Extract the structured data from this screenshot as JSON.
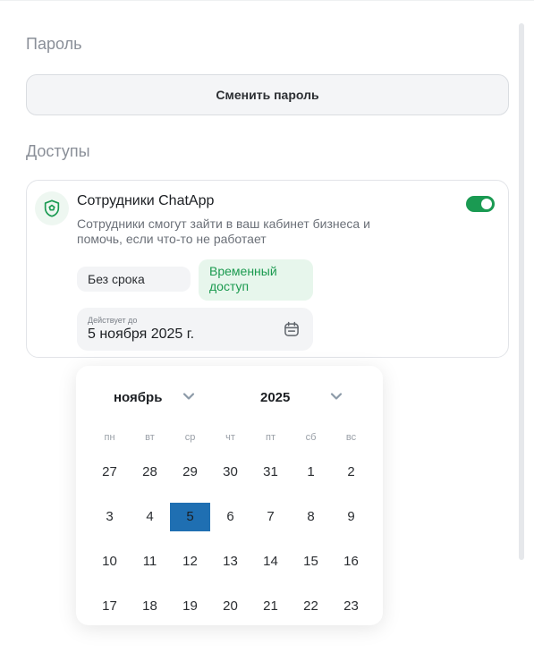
{
  "password": {
    "title": "Пароль",
    "change_button": "Сменить пароль"
  },
  "access": {
    "title": "Доступы",
    "card": {
      "title": "Сотрудники ChatApp",
      "description": "Сотрудники смогут зайти в ваш кабинет бизнеса и помочь, если что-то не работает",
      "toggle_on": true,
      "icon": "shield-icon",
      "options": {
        "no_limit": "Без срока",
        "temporary": "Временный доступ"
      },
      "selected_option": "temporary",
      "valid_until": {
        "label": "Действует до",
        "value": "5 ноября 2025 г.",
        "icon": "calendar-icon"
      }
    }
  },
  "calendar": {
    "month": "ноябрь",
    "year": "2025",
    "weekdays": [
      "пн",
      "вт",
      "ср",
      "чт",
      "пт",
      "сб",
      "вс"
    ],
    "weeks": [
      [
        "27",
        "28",
        "29",
        "30",
        "31",
        "1",
        "2"
      ],
      [
        "3",
        "4",
        "5",
        "6",
        "7",
        "8",
        "9"
      ],
      [
        "10",
        "11",
        "12",
        "13",
        "14",
        "15",
        "16"
      ],
      [
        "17",
        "18",
        "19",
        "20",
        "21",
        "22",
        "23"
      ]
    ],
    "selected_day": "5"
  },
  "colors": {
    "accent_green": "#1a9a52",
    "selected_day": "#1f6fb2",
    "chip_active_bg": "#e7f6ec"
  }
}
